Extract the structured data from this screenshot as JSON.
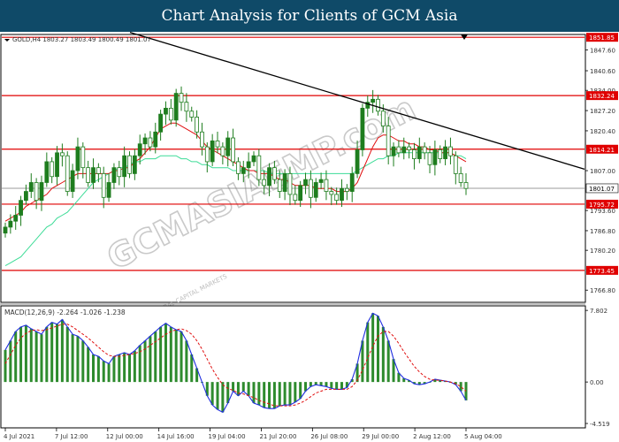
{
  "header": {
    "title": "Chart Analysis for Clients of GCM Asia"
  },
  "chart_data": [
    {
      "type": "candlestick",
      "info": "GOLD,H4  1803.27 1803.49 1800.49 1801.07",
      "watermark": "GCMASIAEMP.com",
      "watermark_sub": "© GLOBAL CAPITAL MARKETS",
      "ylim": [
        1763.0,
        1852.5
      ],
      "y_ticks": [
        "1847.60",
        "1840.60",
        "1834.00",
        "1827.20",
        "1820.40",
        "1807.00",
        "1793.60",
        "1786.80",
        "1780.20",
        "1766.80"
      ],
      "x_ticks": [
        "4 Jul 2021",
        "7 Jul 12:00",
        "12 Jul 00:00",
        "14 Jul 16:00",
        "19 Jul 04:00",
        "21 Jul 20:00",
        "26 Jul 08:00",
        "29 Jul 00:00",
        "2 Aug 12:00",
        "5 Aug 04:00"
      ],
      "levels": [
        {
          "value": 1851.85,
          "label": "1851.85",
          "color": "#e00000"
        },
        {
          "value": 1832.24,
          "label": "1832.24",
          "color": "#e00000"
        },
        {
          "value": 1814.21,
          "label": "1814.21",
          "color": "#e00000"
        },
        {
          "value": 1795.72,
          "label": "1795.72",
          "color": "#e00000"
        },
        {
          "value": 1773.45,
          "label": "1773.45",
          "color": "#e00000"
        }
      ],
      "last_price": {
        "value": 1801.07,
        "label": "1801.07"
      },
      "trendline": {
        "start": [
          0.22,
          1853.5
        ],
        "end": [
          1.0,
          1807.5
        ]
      },
      "close_series": [
        1788,
        1790,
        1792,
        1797,
        1800,
        1803,
        1797,
        1803,
        1810,
        1805,
        1813,
        1812,
        1800,
        1807,
        1815,
        1808,
        1803,
        1808,
        1806,
        1798,
        1803,
        1808,
        1805,
        1812,
        1806,
        1812,
        1816,
        1818,
        1815,
        1820,
        1826,
        1828,
        1824,
        1833,
        1830,
        1827,
        1825,
        1820,
        1815,
        1810,
        1817,
        1815,
        1812,
        1818,
        1810,
        1806,
        1808,
        1810,
        1812,
        1804,
        1802,
        1808,
        1804,
        1800,
        1806,
        1799,
        1797,
        1802,
        1804,
        1798,
        1803,
        1804,
        1800,
        1799,
        1797,
        1801,
        1800,
        1806,
        1814,
        1828,
        1830,
        1831,
        1827,
        1822,
        1812,
        1815,
        1813,
        1815,
        1814,
        1811,
        1815,
        1813,
        1809,
        1814,
        1811,
        1815,
        1812,
        1806,
        1803,
        1801
      ],
      "ma_slow": [
        1775,
        1776,
        1777,
        1778,
        1780,
        1782,
        1784,
        1786,
        1788,
        1789,
        1791,
        1792,
        1793,
        1795,
        1797,
        1799,
        1801,
        1803,
        1804,
        1805,
        1806,
        1807,
        1808,
        1808,
        1809,
        1810,
        1810,
        1811,
        1811,
        1811,
        1812,
        1812,
        1812,
        1812,
        1811,
        1811,
        1810,
        1810,
        1809,
        1809,
        1808,
        1808,
        1808,
        1808,
        1807,
        1807,
        1807,
        1807,
        1807,
        1807,
        1807,
        1806,
        1806,
        1806,
        1806,
        1806,
        1806,
        1806,
        1806,
        1806,
        1806,
        1806,
        1806,
        1806,
        1806,
        1806,
        1806,
        1806,
        1807,
        1808,
        1809,
        1810,
        1811,
        1811,
        1812,
        1812,
        1813,
        1813,
        1813,
        1813,
        1813,
        1813,
        1813,
        1813,
        1813,
        1813,
        1813,
        1812,
        1812,
        1811
      ],
      "ma_fast": [
        1790,
        1791,
        1792,
        1793,
        1795,
        1796,
        1797,
        1798,
        1799,
        1801,
        1802,
        1803,
        1804,
        1805,
        1806,
        1806,
        1806,
        1806,
        1806,
        1806,
        1806,
        1807,
        1807,
        1808,
        1808,
        1810,
        1811,
        1813,
        1815,
        1818,
        1821,
        1822,
        1823,
        1823,
        1822,
        1821,
        1820,
        1819,
        1817,
        1815,
        1814,
        1813,
        1812,
        1811,
        1810,
        1809,
        1808,
        1807,
        1807,
        1806,
        1806,
        1806,
        1805,
        1804,
        1804,
        1803,
        1802,
        1802,
        1802,
        1802,
        1801,
        1801,
        1801,
        1801,
        1800,
        1800,
        1800,
        1801,
        1803,
        1807,
        1811,
        1815,
        1818,
        1819,
        1819,
        1818,
        1817,
        1817,
        1816,
        1816,
        1815,
        1815,
        1814,
        1814,
        1813,
        1813,
        1813,
        1812,
        1811,
        1810
      ]
    },
    {
      "type": "macd",
      "label": "MACD(12,26,9) -2.264 -1.026 -1.238",
      "ylim": [
        -4.9,
        8.2
      ],
      "y_ticks": [
        "7.802",
        "0.00",
        "-4.519"
      ],
      "macd": [
        3.5,
        4.5,
        5.5,
        6.0,
        6.2,
        5.8,
        5.5,
        5.2,
        6.0,
        6.5,
        6.3,
        6.8,
        6.0,
        5.2,
        5.0,
        4.5,
        3.8,
        3.0,
        2.8,
        2.3,
        2.0,
        2.8,
        3.0,
        3.2,
        3.0,
        3.4,
        4.0,
        4.5,
        5.0,
        5.5,
        6.0,
        6.4,
        6.0,
        5.7,
        5.5,
        4.5,
        3.0,
        1.5,
        0.0,
        -1.5,
        -2.5,
        -3.0,
        -3.3,
        -2.3,
        -1.0,
        -1.5,
        -1.0,
        -1.5,
        -2.3,
        -2.5,
        -2.8,
        -2.9,
        -2.9,
        -2.6,
        -2.5,
        -2.5,
        -2.2,
        -1.8,
        -1.0,
        -0.5,
        -0.3,
        -0.4,
        -0.5,
        -0.7,
        -0.8,
        -0.8,
        -0.6,
        0.3,
        2.0,
        4.5,
        6.5,
        7.5,
        7.2,
        6.0,
        4.5,
        2.5,
        1.0,
        0.4,
        0.2,
        -0.2,
        -0.3,
        -0.2,
        0.0,
        0.3,
        0.2,
        0.1,
        0.0,
        -0.3,
        -1.0,
        -2.0
      ],
      "signal": [
        2.0,
        3.0,
        4.0,
        4.8,
        5.3,
        5.6,
        5.7,
        5.6,
        5.7,
        5.9,
        6.1,
        6.3,
        6.3,
        6.0,
        5.6,
        5.2,
        4.8,
        4.3,
        3.8,
        3.3,
        2.9,
        2.8,
        2.8,
        2.9,
        3.0,
        3.1,
        3.3,
        3.6,
        4.0,
        4.4,
        4.8,
        5.2,
        5.5,
        5.7,
        5.8,
        5.6,
        5.2,
        4.5,
        3.6,
        2.5,
        1.4,
        0.5,
        -0.3,
        -0.7,
        -0.9,
        -1.2,
        -1.3,
        -1.5,
        -1.7,
        -2.0,
        -2.2,
        -2.4,
        -2.6,
        -2.6,
        -2.6,
        -2.6,
        -2.5,
        -2.3,
        -2.0,
        -1.6,
        -1.2,
        -1.0,
        -0.8,
        -0.8,
        -0.8,
        -0.8,
        -0.8,
        -0.5,
        0.2,
        1.3,
        2.6,
        3.9,
        5.0,
        5.5,
        5.5,
        5.0,
        4.2,
        3.3,
        2.5,
        1.7,
        1.1,
        0.6,
        0.3,
        0.2,
        0.2,
        0.1,
        0.0,
        -0.2,
        -0.5,
        -1.0
      ]
    }
  ]
}
